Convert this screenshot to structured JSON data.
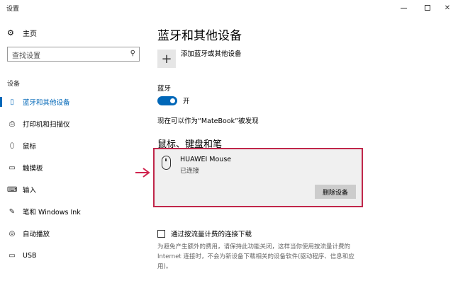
{
  "window": {
    "title": "设置"
  },
  "sidebar": {
    "home_label": "主页",
    "search_placeholder": "查找设置",
    "section_label": "设备",
    "items": [
      {
        "label": "蓝牙和其他设备",
        "icon": "bluetooth-devices-icon",
        "active": true
      },
      {
        "label": "打印机和扫描仪",
        "icon": "printer-icon",
        "active": false
      },
      {
        "label": "鼠标",
        "icon": "mouse-icon",
        "active": false
      },
      {
        "label": "触摸板",
        "icon": "touchpad-icon",
        "active": false
      },
      {
        "label": "输入",
        "icon": "keyboard-icon",
        "active": false
      },
      {
        "label": "笔和 Windows Ink",
        "icon": "pen-icon",
        "active": false
      },
      {
        "label": "自动播放",
        "icon": "autoplay-icon",
        "active": false
      },
      {
        "label": "USB",
        "icon": "usb-icon",
        "active": false
      }
    ]
  },
  "main": {
    "title": "蓝牙和其他设备",
    "add_device_label": "添加蓝牙或其他设备",
    "bluetooth_label": "蓝牙",
    "bluetooth_toggle_text": "开",
    "bluetooth_on": true,
    "discoverable_text": "现在可以作为“MateBook”被发现",
    "mouse_section_title": "鼠标、键盘和笔",
    "device": {
      "name": "HUAWEI Mouse",
      "status": "已连接",
      "remove_label": "删除设备"
    },
    "metered_label": "通过按流量计费的连接下载",
    "metered_checked": false,
    "metered_description": "为避免产生额外的费用，请保持此功能关闭，这样当你使用按流量计费的 Internet 连接时，不会为新设备下载相关的设备软件(驱动程序、信息和应用)。"
  },
  "colors": {
    "accent": "#0067b8",
    "highlight_border": "#c0264a",
    "arrow": "#d0234d"
  }
}
